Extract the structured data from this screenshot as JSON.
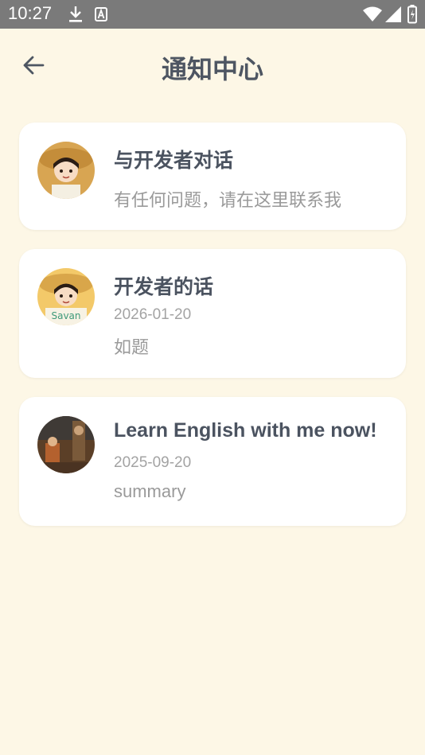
{
  "status_bar": {
    "time": "10:27",
    "icons": [
      "download-icon",
      "a-badge-icon",
      "wifi-icon",
      "signal-icon",
      "battery-icon"
    ]
  },
  "header": {
    "title": "通知中心",
    "back_icon": "arrow-left-icon"
  },
  "notifications": [
    {
      "title": "与开发者对话",
      "subtitle": "有任何问题，请在这里联系我"
    },
    {
      "title": "开发者的话",
      "date": "2026-01-20",
      "summary": "如题",
      "avatar_label": "Savan"
    },
    {
      "title": "Learn English with me now!",
      "date": "2025-09-20",
      "summary": "summary"
    }
  ],
  "colors": {
    "background": "#fdf7e6",
    "status_bar": "#7a7a7a",
    "title_text": "#4e5662",
    "secondary_text": "#9a9a9a",
    "card": "#ffffff"
  }
}
